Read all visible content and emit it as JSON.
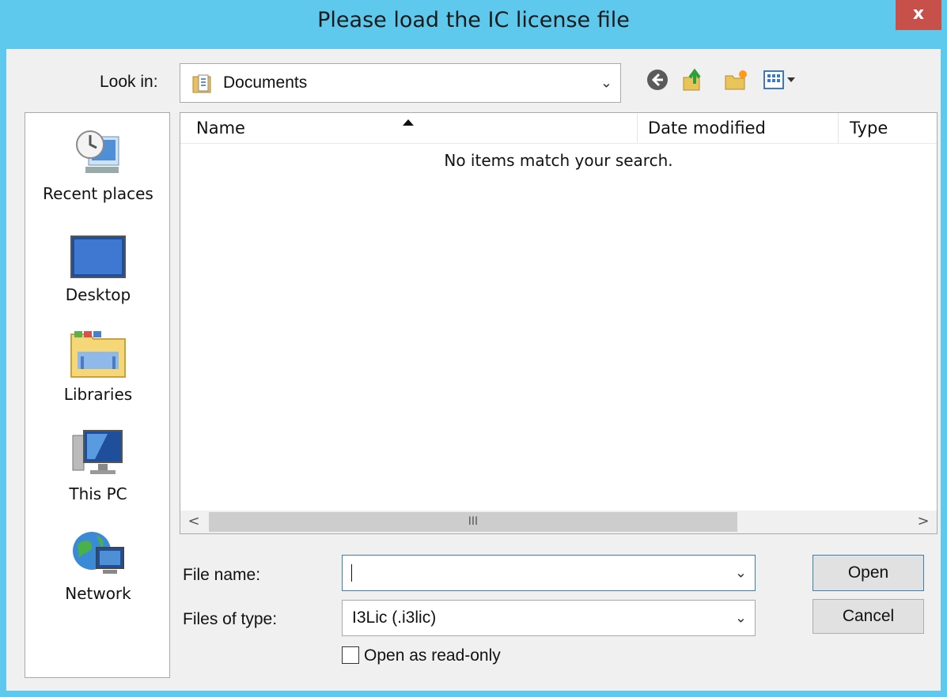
{
  "window": {
    "title": "Please load the IC license file",
    "close_glyph": "x"
  },
  "look_in": {
    "label": "Look in:",
    "value": "Documents"
  },
  "toolbar": {
    "icons": [
      "back-icon",
      "up-folder-icon",
      "new-folder-icon",
      "view-menu-icon"
    ]
  },
  "places": [
    {
      "label": "Recent places",
      "icon": "recent-places-icon"
    },
    {
      "label": "Desktop",
      "icon": "desktop-icon"
    },
    {
      "label": "Libraries",
      "icon": "libraries-icon"
    },
    {
      "label": "This PC",
      "icon": "this-pc-icon"
    },
    {
      "label": "Network",
      "icon": "network-icon"
    }
  ],
  "file_list": {
    "columns": [
      "Name",
      "Date modified",
      "Type"
    ],
    "sorted_column": "Name",
    "empty_message": "No items match your search."
  },
  "scrollbar": {
    "left_glyph": "<",
    "right_glyph": ">",
    "thumb_glyph": "III"
  },
  "file_name": {
    "label": "File name:",
    "value": ""
  },
  "file_type": {
    "label": "Files of type:",
    "value": "I3Lic (.i3lic)"
  },
  "read_only": {
    "label": "Open as read-only",
    "checked": false
  },
  "buttons": {
    "open": "Open",
    "cancel": "Cancel"
  },
  "colors": {
    "title_bar": "#5fc8ed",
    "close_button": "#c7504a",
    "focus_border": "#3c7fb1"
  }
}
